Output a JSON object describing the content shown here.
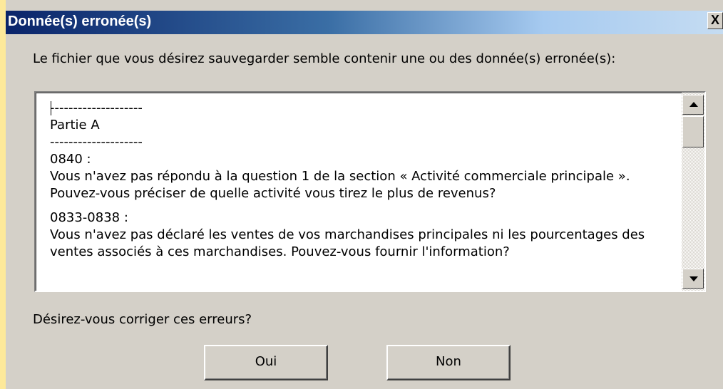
{
  "window": {
    "title": "Donnée(s) erronée(s)",
    "close_label": "X"
  },
  "message": "Le fichier que vous désirez sauvegarder semble contenir une ou des donnée(s) erronée(s):",
  "errors_list": {
    "lines": [
      "--------------------",
      "Partie A",
      "--------------------",
      "0840 :",
      "Vous n'avez pas répondu à la question 1 de la section « Activité commerciale principale ».",
      "Pouvez-vous préciser de quelle activité vous tirez le plus de revenus?",
      "",
      "0833-0838 :",
      "Vous n'avez pas déclaré les ventes de vos marchandises principales ni les pourcentages des",
      "ventes associés à ces marchandises.  Pouvez-vous fournir l'information?"
    ]
  },
  "question": "Désirez-vous  corriger ces erreurs?",
  "buttons": {
    "yes_label": "Oui",
    "no_label": "Non"
  }
}
